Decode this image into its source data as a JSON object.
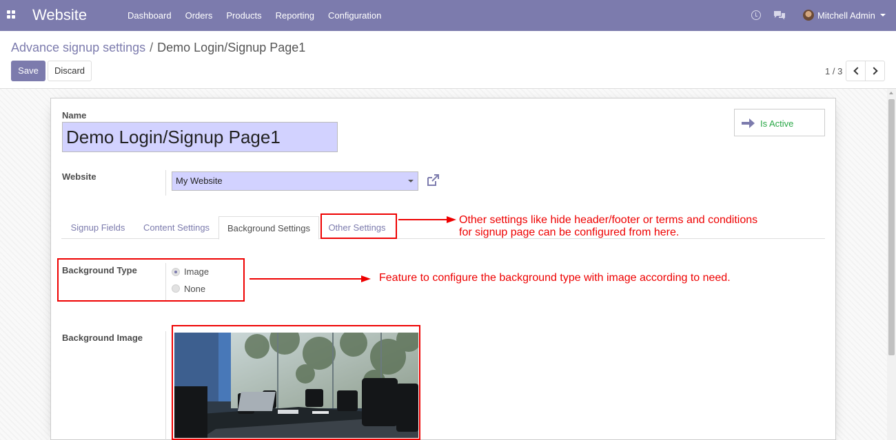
{
  "navbar": {
    "brand": "Website",
    "menu": [
      "Dashboard",
      "Orders",
      "Products",
      "Reporting",
      "Configuration"
    ],
    "user": "Mitchell Admin",
    "bg_color": "#7c7bad"
  },
  "breadcrumb": {
    "parent": "Advance signup settings",
    "separator": "/",
    "current": "Demo Login/Signup Page1"
  },
  "buttons": {
    "save": "Save",
    "discard": "Discard"
  },
  "pager": {
    "value": "1 / 3"
  },
  "form": {
    "name_label": "Name",
    "name_value": "Demo Login/Signup Page1",
    "active_label": "Is Active",
    "website_label": "Website",
    "website_value": "My Website",
    "tabs": [
      "Signup Fields",
      "Content Settings",
      "Background Settings",
      "Other Settings"
    ],
    "active_tab": "Background Settings",
    "bg_type_label": "Background Type",
    "bg_type_options": [
      "Image",
      "None"
    ],
    "bg_type_selected": "Image",
    "bg_image_label": "Background Image"
  },
  "annotations": {
    "other_settings_line1": "Other settings like hide header/footer or terms and conditions",
    "other_settings_line2": "for signup page can be configured from here.",
    "background_type": "Feature to configure the background type with image according to need.",
    "color": "#ee0000"
  }
}
